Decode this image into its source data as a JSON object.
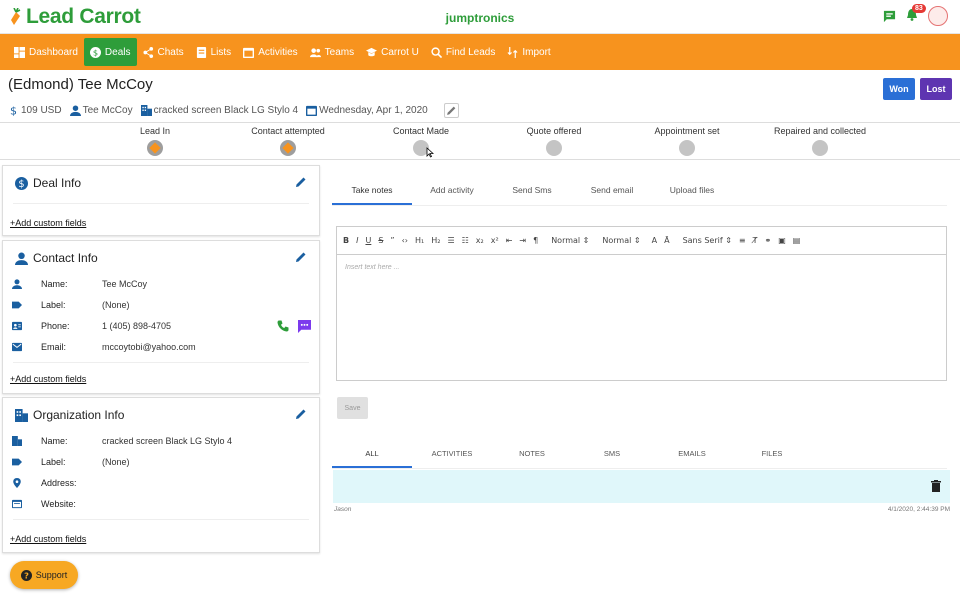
{
  "app": {
    "logo_text": "Lead Carrot",
    "company": "jumptronics",
    "notification_count": "83"
  },
  "nav": [
    {
      "label": "Dashboard",
      "icon": "dashboard-icon"
    },
    {
      "label": "Deals",
      "icon": "dollar-icon",
      "active": true
    },
    {
      "label": "Chats",
      "icon": "share-icon"
    },
    {
      "label": "Lists",
      "icon": "list-icon"
    },
    {
      "label": "Activities",
      "icon": "calendar-icon"
    },
    {
      "label": "Teams",
      "icon": "people-icon"
    },
    {
      "label": "Carrot U",
      "icon": "graduation-icon"
    },
    {
      "label": "Find Leads",
      "icon": "search-icon"
    },
    {
      "label": "Import",
      "icon": "import-icon"
    }
  ],
  "deal": {
    "title": "(Edmond) Tee McCoy",
    "value": "109 USD",
    "person": "Tee McCoy",
    "organization": "cracked screen Black LG Stylo 4",
    "date": "Wednesday, Apr 1, 2020",
    "won_label": "Won",
    "lost_label": "Lost"
  },
  "pipeline": [
    {
      "label": "Lead In",
      "done": true
    },
    {
      "label": "Contact attempted",
      "done": true
    },
    {
      "label": "Contact Made",
      "done": false
    },
    {
      "label": "Quote offered",
      "done": false
    },
    {
      "label": "Appointment set",
      "done": false
    },
    {
      "label": "Repaired and collected",
      "done": false
    }
  ],
  "deal_info": {
    "title": "Deal Info",
    "add_custom": "+Add custom fields"
  },
  "contact_info": {
    "title": "Contact Info",
    "name_label": "Name:",
    "name": "Tee McCoy",
    "label_label": "Label:",
    "label": "(None)",
    "phone_label": "Phone:",
    "phone": "1 (405) 898-4705",
    "email_label": "Email:",
    "email": "mccoytobi@yahoo.com",
    "add_custom": "+Add custom fields"
  },
  "org_info": {
    "title": "Organization Info",
    "name_label": "Name:",
    "name": "cracked screen Black LG Stylo 4",
    "label_label": "Label:",
    "label": "(None)",
    "address_label": "Address:",
    "website_label": "Website:",
    "add_custom": "+Add custom fields"
  },
  "tabs": [
    "Take notes",
    "Add activity",
    "Send Sms",
    "Send email",
    "Upload files"
  ],
  "editor": {
    "placeholder": "Insert text here ...",
    "heading1": "Normal",
    "heading2": "Normal",
    "font": "Sans Serif",
    "save_label": "Save"
  },
  "feed_tabs": [
    "ALL",
    "ACTIVITIES",
    "NOTES",
    "SMS",
    "EMAILS",
    "FILES"
  ],
  "feed": {
    "author": "Jason",
    "time": "4/1/2020, 2:44:39 PM"
  },
  "support_label": "Support",
  "colors": {
    "brand_green": "#2e9d3a",
    "brand_orange": "#f7931e",
    "won": "#2a6fd6",
    "lost": "#5e35b1"
  }
}
